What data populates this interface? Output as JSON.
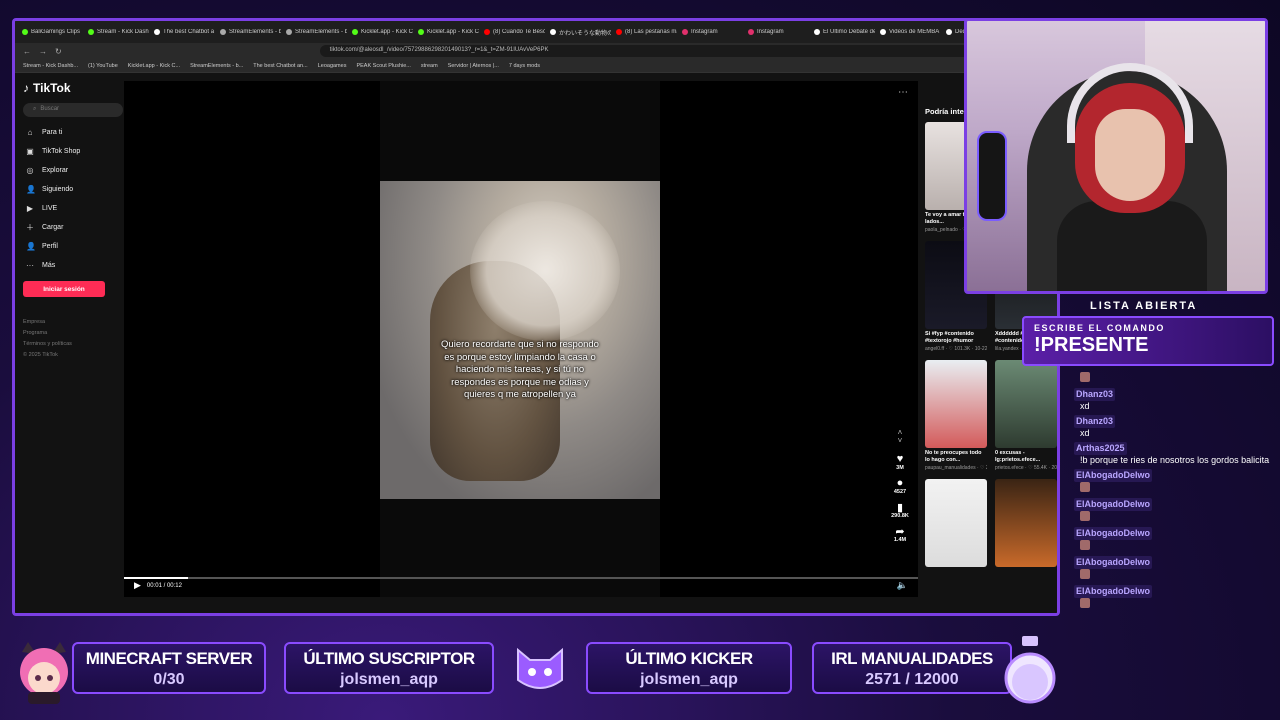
{
  "browser": {
    "tabs": [
      {
        "label": "BaliGamings Clips",
        "color": "#53fc18"
      },
      {
        "label": "Stream - Kick Dashb",
        "color": "#53fc18"
      },
      {
        "label": "The best Chatbot a",
        "color": "#ffffff"
      },
      {
        "label": "StreamElements - b",
        "color": "#aaaaaa"
      },
      {
        "label": "StreamElements - b",
        "color": "#aaaaaa"
      },
      {
        "label": "Kicklet.app - Kick C",
        "color": "#53fc18"
      },
      {
        "label": "Kicklet.app - Kick C",
        "color": "#53fc18"
      },
      {
        "label": "(8) Cuando Te Besó",
        "color": "#ff0000"
      },
      {
        "label": "かわいそうな動物の",
        "color": "#ffffff"
      },
      {
        "label": "(8) Las pestañas má",
        "color": "#ff0000"
      },
      {
        "label": "Instagram",
        "color": "#e1306c"
      },
      {
        "label": "Instagram",
        "color": "#e1306c"
      },
      {
        "label": "El Último Debate de",
        "color": "#ffffff"
      },
      {
        "label": "Videos de MEMBA",
        "color": "#ffffff"
      },
      {
        "label": "Dedicatorias p",
        "color": "#ffffff"
      }
    ],
    "url": "tiktok.com/@aleosdl_/video/7572988629820149013?_r=1&_t=ZM-91IUAvVeP6PK",
    "bookmarks": [
      "Stream - Kick Dashb...",
      "(1) YouTube",
      "Kicklet.app - Kick C...",
      "StreamElements - b...",
      "The best Chatbot an...",
      "Leoagames",
      "PEAK Scout Plushie...",
      "stream",
      "Servidor | Aternos |...",
      "7 days mods"
    ]
  },
  "tiktok": {
    "logo": "TikTok",
    "search_placeholder": "Buscar",
    "nav": [
      {
        "label": "Para ti",
        "icon": "home-icon",
        "glyph": "⌂"
      },
      {
        "label": "TikTok Shop",
        "icon": "shop-icon",
        "glyph": "▣"
      },
      {
        "label": "Explorar",
        "icon": "compass-icon",
        "glyph": "◎"
      },
      {
        "label": "Siguiendo",
        "icon": "following-icon",
        "glyph": "👤"
      },
      {
        "label": "LIVE",
        "icon": "live-icon",
        "glyph": "▶"
      },
      {
        "label": "Cargar",
        "icon": "upload-icon",
        "glyph": "＋"
      },
      {
        "label": "Perfil",
        "icon": "profile-icon",
        "glyph": "👤"
      },
      {
        "label": "Más",
        "icon": "more-icon",
        "glyph": "···"
      }
    ],
    "login_label": "Iniciar sesión",
    "footer": [
      "Empresa",
      "Programa",
      "Términos y políticas",
      "© 2025 TikTok"
    ],
    "video": {
      "caption": "Quiero recordarte que si no respondo es porque estoy limpiando la casa o haciendo mis tareas, y si tú no respondes es porque me odias y quieres q me atropellen ya",
      "time": "00:01 / 00:12",
      "progress": 0.08,
      "likes": "3M",
      "comments": "4527",
      "saves": "290.8K",
      "shares": "1.4M"
    },
    "recs_title": "Podría inte",
    "recs": [
      {
        "title": "Te voy a amar todos lados...",
        "meta": "paola_pelnado · ♡ 43K · 8-20",
        "bg": "linear-gradient(180deg,#e8e2e0,#b9b0ad)"
      },
      {
        "title": "",
        "meta": "",
        "bg": "#0e0e0e"
      },
      {
        "title": "Si #fyp #contenido #textorojo #humor",
        "meta": "angel0.ff · ♡ 101.3K · 10-22",
        "bg": "linear-gradient(180deg,#0c0c14,#1a1a28)"
      },
      {
        "title": "Xdddddd #fyp #contenido",
        "meta": "lila.yandex · ♡ 2886 · 10-8",
        "bg": "linear-gradient(180deg,#111,#2a2f35)"
      },
      {
        "title": "No te preocupes todo lo hago con...",
        "meta": "paupau_manualidades · ♡ 236.6K · 10-3",
        "bg": "linear-gradient(180deg,#e9eef2,#d35a5a)"
      },
      {
        "title": "0 excusas - lg:prietos.efece...",
        "meta": "prietos.efece · ♡ 55.4K · 2024-8-23",
        "bg": "linear-gradient(180deg,#6b8a74,#2e3b30)"
      },
      {
        "title": "",
        "meta": "",
        "bg": "linear-gradient(180deg,#f2f2f2,#dcdcdc)"
      },
      {
        "title": "",
        "meta": "",
        "bg": "linear-gradient(180deg,#3a2414,#c96a2a)"
      }
    ]
  },
  "overlay": {
    "lista": "LISTA ABIERTA",
    "cmd_line1": "ESCRIBE EL COMANDO",
    "cmd_line2": "!PRESENTE",
    "panels": [
      {
        "title": "MINECRAFT SERVER",
        "value": "0/30"
      },
      {
        "title": "ÚLTIMO SUSCRIPTOR",
        "value": "jolsmen_aqp"
      },
      {
        "title": "ÚLTIMO KICKER",
        "value": "jolsmen_aqp"
      },
      {
        "title": "IRL MANUALIDADES",
        "value": "2571 / 12000"
      }
    ]
  },
  "chat": [
    {
      "user": "",
      "text": ""
    },
    {
      "user": "Dhanz03",
      "text": "xd"
    },
    {
      "user": "Dhanz03",
      "text": "xd"
    },
    {
      "user": "Arthas2025",
      "text": "!b porque te ries de nosotros los gordos balicita"
    },
    {
      "user": "ElAbogadoDelwo",
      "text": ""
    },
    {
      "user": "ElAbogadoDelwo",
      "text": ""
    },
    {
      "user": "ElAbogadoDelwo",
      "text": ""
    },
    {
      "user": "ElAbogadoDelwo",
      "text": ""
    },
    {
      "user": "ElAbogadoDelwo",
      "text": ""
    }
  ]
}
